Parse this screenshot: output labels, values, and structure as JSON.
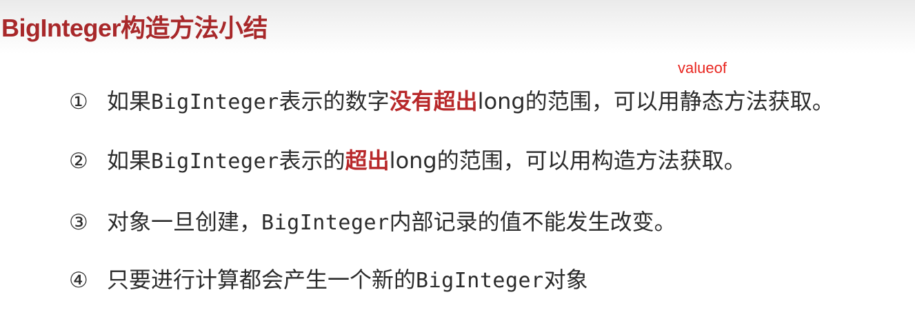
{
  "title": "BigInteger构造方法小结",
  "annotation": "valueof",
  "items": [
    {
      "number": "①",
      "pre": "如果",
      "code": "BigInteger",
      "mid": "表示的数字",
      "highlight": "没有超出",
      "after_code": "long",
      "post": "的范围，可以用静态方法获取。"
    },
    {
      "number": "②",
      "pre": "如果",
      "code": "BigInteger",
      "mid": "表示的",
      "highlight": "超出",
      "after_code": "long",
      "post": "的范围，可以用构造方法获取。"
    },
    {
      "number": "③",
      "pre": "对象一旦创建，",
      "code": "BigInteger",
      "post": "内部记录的值不能发生改变。"
    },
    {
      "number": "④",
      "pre": "只要进行计算都会产生一个新的",
      "code": "BigInteger",
      "post": "对象"
    }
  ],
  "colors": {
    "title": "#a8282a",
    "highlight": "#b8282a",
    "annotation": "#e8251f",
    "body_text": "#2b2b2b"
  }
}
